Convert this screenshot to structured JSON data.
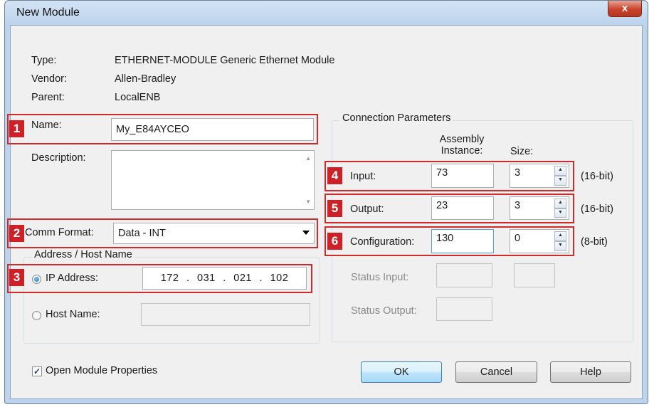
{
  "window": {
    "title": "New Module",
    "close_label": "x"
  },
  "info": {
    "type_label": "Type:",
    "type_value": "ETHERNET-MODULE Generic Ethernet Module",
    "vendor_label": "Vendor:",
    "vendor_value": "Allen-Bradley",
    "parent_label": "Parent:",
    "parent_value": "LocalENB"
  },
  "badges": [
    "1",
    "2",
    "3",
    "4",
    "5",
    "6"
  ],
  "name": {
    "label": "Name:",
    "value": "My_E84AYCEO"
  },
  "description": {
    "label": "Description:",
    "value": ""
  },
  "comm_format": {
    "label": "Comm Format:",
    "value": "Data - INT"
  },
  "address": {
    "group_title": "Address / Host Name",
    "ip_label": "IP Address:",
    "ip_octets": [
      "172",
      "031",
      "021",
      "102"
    ],
    "ip_dot": ".",
    "host_label": "Host Name:",
    "host_value": ""
  },
  "connection": {
    "group_title": "Connection Parameters",
    "col_assembly": "Assembly Instance:",
    "col_size": "Size:",
    "rows": [
      {
        "label": "Input:",
        "instance": "73",
        "size": "3",
        "unit": "(16-bit)"
      },
      {
        "label": "Output:",
        "instance": "23",
        "size": "3",
        "unit": "(16-bit)"
      },
      {
        "label": "Configuration:",
        "instance": "130",
        "size": "0",
        "unit": "(8-bit)"
      }
    ],
    "status_input_label": "Status Input:",
    "status_output_label": "Status Output:"
  },
  "open_props": {
    "label": "Open Module Properties",
    "checked": true,
    "check_glyph": "✓"
  },
  "buttons": {
    "ok": "OK",
    "cancel": "Cancel",
    "help": "Help"
  }
}
